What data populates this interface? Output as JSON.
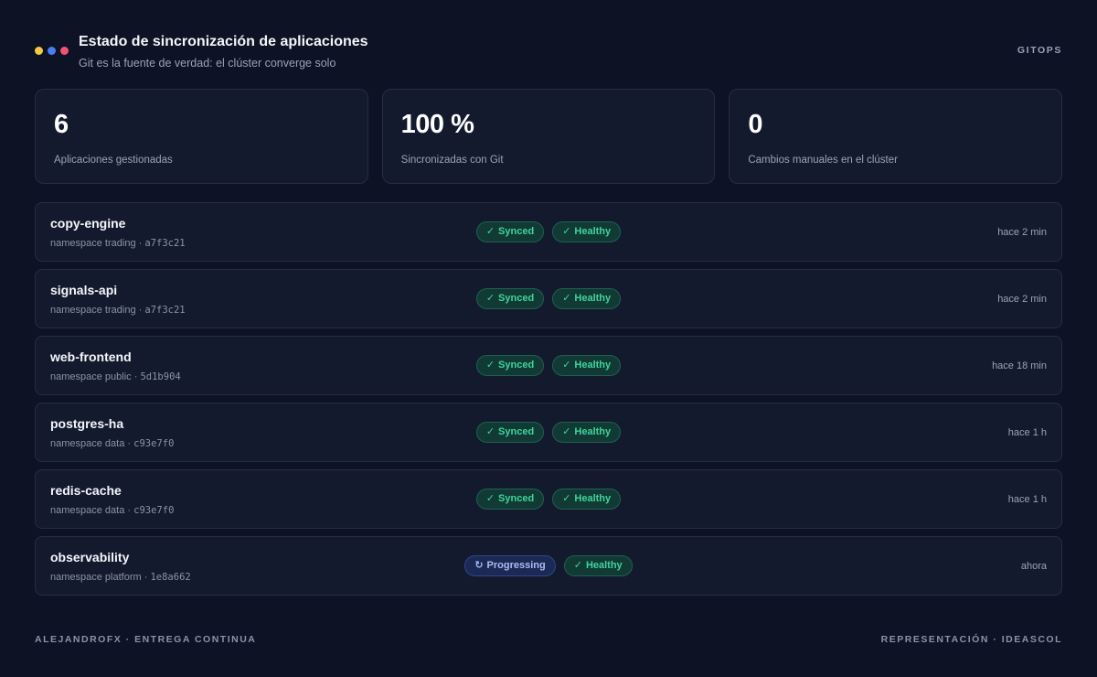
{
  "header": {
    "title": "Estado de sincronización de aplicaciones",
    "subtitle": "Git es la fuente de verdad: el clúster converge solo",
    "tag": "GITOPS",
    "dots": [
      "#f5c842",
      "#4a7df0",
      "#f0556e"
    ]
  },
  "stats": [
    {
      "value": "6",
      "label": "Aplicaciones gestionadas"
    },
    {
      "value": "100 %",
      "label": "Sincronizadas con Git"
    },
    {
      "value": "0",
      "label": "Cambios manuales en el clúster"
    }
  ],
  "apps": [
    {
      "name": "copy-engine",
      "namespace": "namespace trading",
      "commit": "a7f3c21",
      "sync": {
        "icon": "✓",
        "label": "Synced",
        "kind": "green"
      },
      "health": {
        "icon": "✓",
        "label": "Healthy"
      },
      "time": "hace 2 min"
    },
    {
      "name": "signals-api",
      "namespace": "namespace trading",
      "commit": "a7f3c21",
      "sync": {
        "icon": "✓",
        "label": "Synced",
        "kind": "green"
      },
      "health": {
        "icon": "✓",
        "label": "Healthy"
      },
      "time": "hace 2 min"
    },
    {
      "name": "web-frontend",
      "namespace": "namespace public",
      "commit": "5d1b904",
      "sync": {
        "icon": "✓",
        "label": "Synced",
        "kind": "green"
      },
      "health": {
        "icon": "✓",
        "label": "Healthy"
      },
      "time": "hace 18 min"
    },
    {
      "name": "postgres-ha",
      "namespace": "namespace data",
      "commit": "c93e7f0",
      "sync": {
        "icon": "✓",
        "label": "Synced",
        "kind": "green"
      },
      "health": {
        "icon": "✓",
        "label": "Healthy"
      },
      "time": "hace 1 h"
    },
    {
      "name": "redis-cache",
      "namespace": "namespace data",
      "commit": "c93e7f0",
      "sync": {
        "icon": "✓",
        "label": "Synced",
        "kind": "green"
      },
      "health": {
        "icon": "✓",
        "label": "Healthy"
      },
      "time": "hace 1 h"
    },
    {
      "name": "observability",
      "namespace": "namespace platform",
      "commit": "1e8a662",
      "sync": {
        "icon": "↻",
        "label": "Progressing",
        "kind": "blue"
      },
      "health": {
        "icon": "✓",
        "label": "Healthy"
      },
      "time": "ahora"
    }
  ],
  "meta_separator": "·",
  "footer": {
    "left": "ALEJANDROFX · ENTREGA CONTINUA",
    "right": "REPRESENTACIÓN · IDEASCOL"
  }
}
